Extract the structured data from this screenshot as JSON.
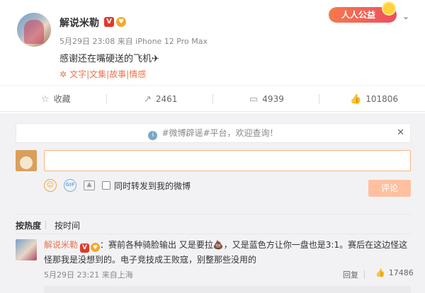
{
  "post": {
    "author": "解说米勒",
    "verified_badge": "V",
    "meta": "5月29日 23:08 来自 iPhone 12 Pro Max",
    "text": "感谢还在嘴硬送的飞机✈",
    "links": "文字|文集|故事|情感",
    "charity_label": "人人公益"
  },
  "actions": {
    "favorite_label": "收藏",
    "repost_count": "2461",
    "comment_count": "4939",
    "like_count": "101806"
  },
  "comment_panel": {
    "notice": "#微博辟谣#平台，欢迎查询！",
    "input_value": "",
    "forward_label": "同时转发到我的微博",
    "submit_label": "评论",
    "sort_hot": "按热度",
    "sort_time": "按时间"
  },
  "comments": [
    {
      "author": "解说米勒",
      "text": "：赛前各种骑脸输出 又是要拉💩，又是蓝色方让你一盘也是3:1。赛后在这边怪这怪那我是没想到的。电子竞技成王败寇，别整那些没用的",
      "meta": "5月29日 23:21 来自上海",
      "reply_label": "回复",
      "like_count": "17486"
    }
  ],
  "colors": {
    "accent": "#eb7350",
    "submit_disabled": "#ffc09f",
    "input_border": "#f7b37a"
  }
}
